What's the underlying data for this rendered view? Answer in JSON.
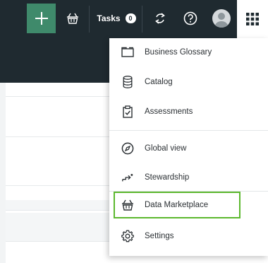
{
  "navbar": {
    "tasks_label": "Tasks",
    "tasks_count": "0"
  },
  "menu": {
    "items": [
      {
        "label": "Business Glossary",
        "icon": "folder-icon"
      },
      {
        "label": "Catalog",
        "icon": "database-icon"
      },
      {
        "label": "Assessments",
        "icon": "clipboard-check-icon"
      },
      {
        "label": "Global view",
        "icon": "compass-icon"
      },
      {
        "label": "Stewardship",
        "icon": "stewardship-icon"
      },
      {
        "label": "Data Marketplace",
        "icon": "basket-icon"
      },
      {
        "label": "Settings",
        "icon": "gear-icon"
      }
    ],
    "highlight_color": "#5cb82e"
  },
  "colors": {
    "navbar_bg": "#1f2a30",
    "add_button_bg": "#3f8a6b"
  }
}
